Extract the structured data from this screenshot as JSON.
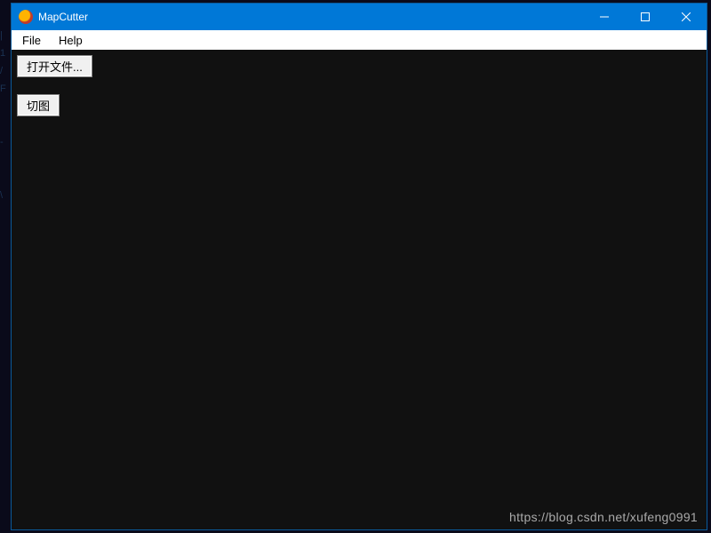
{
  "title": "MapCutter",
  "menus": {
    "file": "File",
    "help": "Help"
  },
  "buttons": {
    "open_file": "打开文件...",
    "cut_map": "切图"
  },
  "caption_buttons": {
    "minimize": "minimize",
    "maximize": "maximize",
    "close": "close"
  },
  "watermark": "https://blog.csdn.net/xufeng0991"
}
